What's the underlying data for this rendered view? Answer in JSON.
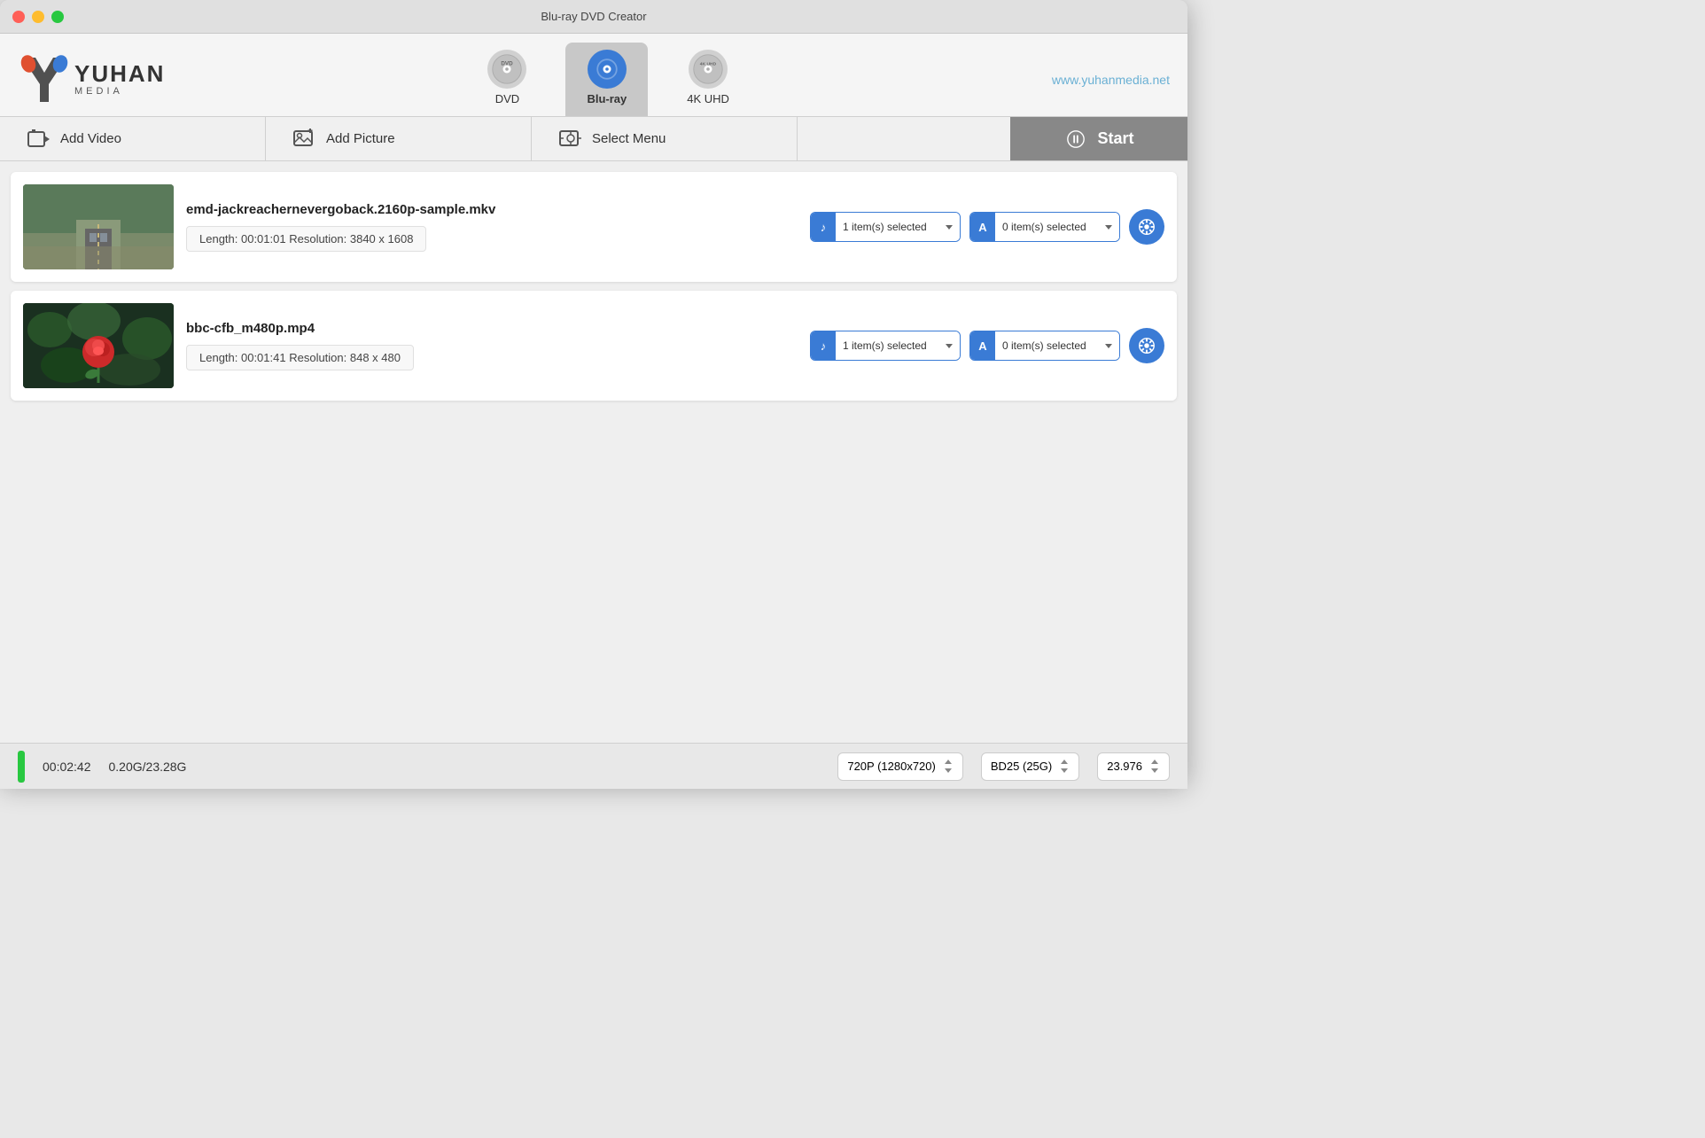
{
  "window": {
    "title": "Blu-ray DVD Creator"
  },
  "header": {
    "logo": {
      "name_top": "YUHAN",
      "name_bottom": "MEDIA"
    },
    "website": "www.yuhanmedia.net",
    "format_tabs": [
      {
        "id": "dvd",
        "label": "DVD",
        "active": false
      },
      {
        "id": "bluray",
        "label": "Blu-ray",
        "active": true
      },
      {
        "id": "4kuhd",
        "label": "4K UHD",
        "active": false
      }
    ]
  },
  "toolbar": {
    "add_video_label": "Add Video",
    "add_picture_label": "Add Picture",
    "select_menu_label": "Select Menu",
    "start_label": "Start"
  },
  "videos": [
    {
      "name": "emd-jackreachernevergoback.2160p-sample.mkv",
      "length": "Length: 00:01:01",
      "resolution": "Resolution: 3840 x 1608",
      "audio_selected": "1 item(s) selected",
      "subtitle_selected": "0 item(s) selected"
    },
    {
      "name": "bbc-cfb_m480p.mp4",
      "length": "Length: 00:01:41",
      "resolution": "Resolution: 848 x 480",
      "audio_selected": "1 item(s) selected",
      "subtitle_selected": "0 item(s) selected"
    }
  ],
  "status_bar": {
    "time": "00:02:42",
    "size": "0.20G/23.28G",
    "resolution_option": "720P (1280x720)",
    "disc_option": "BD25 (25G)",
    "fps_option": "23.976"
  },
  "icons": {
    "audio_badge": "♪",
    "subtitle_badge": "A"
  }
}
